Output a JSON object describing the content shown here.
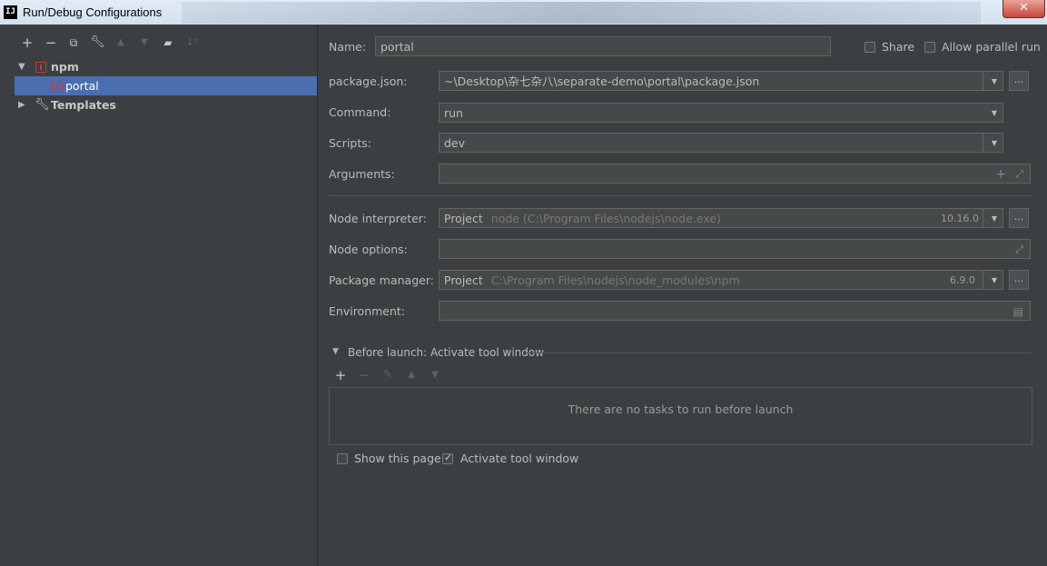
{
  "window": {
    "title": "Run/Debug Configurations",
    "close_label": "✕",
    "app_icon_label": "IJ"
  },
  "toolbar": {
    "icons": [
      "add-icon",
      "remove-icon",
      "copy-icon",
      "wrench-icon",
      "move-up-icon",
      "move-down-icon",
      "new-folder-icon",
      "sort-icon"
    ]
  },
  "tree": {
    "npm_label": "npm",
    "portal_label": "portal",
    "templates_label": "Templates"
  },
  "form": {
    "name_label": "Name:",
    "name_value": "portal",
    "share_label": "Share",
    "parallel_label": "Allow parallel run",
    "package_json_label": "package.json:",
    "package_json_value": "~\\Desktop\\杂七杂八\\separate-demo\\portal\\package.json",
    "command_label": "Command:",
    "command_value": "run",
    "scripts_label": "Scripts:",
    "scripts_value": "dev",
    "arguments_label": "Arguments:",
    "arguments_value": "",
    "node_interpreter_label": "Node interpreter:",
    "node_interpreter_prefix": "Project",
    "node_interpreter_value": "node (C:\\Program Files\\nodejs\\node.exe)",
    "node_version": "10.16.0",
    "node_options_label": "Node options:",
    "node_options_value": "",
    "package_manager_label": "Package manager:",
    "package_manager_prefix": "Project",
    "package_manager_value": "C:\\Program Files\\nodejs\\node_modules\\npm",
    "package_manager_version": "6.9.0",
    "environment_label": "Environment:",
    "environment_value": "",
    "ellipsis": "...",
    "before_launch_label": "Before launch: Activate tool window",
    "no_tasks_text": "There are no tasks to run before launch",
    "show_page_label": "Show this page",
    "activate_tool_label": "Activate tool window"
  },
  "checkboxes": {
    "share": false,
    "parallel": false,
    "show_page": false,
    "activate_tool": true
  }
}
